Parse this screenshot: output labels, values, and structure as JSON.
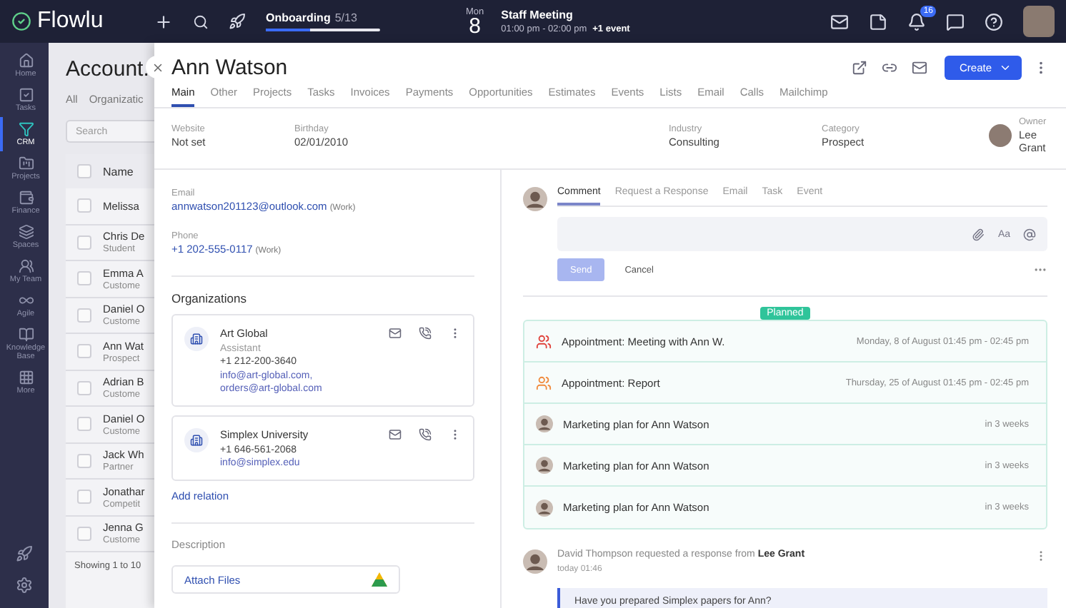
{
  "topbar": {
    "logo": "Flowlu",
    "onboarding": {
      "label": "Onboarding",
      "count": "5/13",
      "level": 0.385
    },
    "event": {
      "weekday": "Mon",
      "day": "8",
      "title": "Staff Meeting",
      "time": "01:00 pm - 02:00 pm",
      "more": "+1 event"
    },
    "notifications": "16"
  },
  "sidebar": [
    {
      "label": "Home",
      "selected": false
    },
    {
      "label": "Tasks",
      "selected": false
    },
    {
      "label": "CRM",
      "selected": true
    },
    {
      "label": "Projects",
      "selected": false
    },
    {
      "label": "Finance",
      "selected": false
    },
    {
      "label": "Spaces",
      "selected": false
    },
    {
      "label": "My Team",
      "selected": false
    },
    {
      "label": "Agile",
      "selected": false
    },
    {
      "label": "Knowledge Base",
      "selected": false
    },
    {
      "label": "More",
      "selected": false
    }
  ],
  "list": {
    "title": "Account.",
    "tabs": [
      {
        "label": "All",
        "selected": false
      },
      {
        "label": "Organizatic",
        "selected": false
      }
    ],
    "search": {
      "placeholder": "Search"
    },
    "column": "Name",
    "all_checked": false,
    "rows": [
      {
        "name": "Melissa",
        "sub": "",
        "checked": false
      },
      {
        "name": "Chris De",
        "sub": "Student",
        "checked": false
      },
      {
        "name": "Emma A",
        "sub": "Custome",
        "checked": false
      },
      {
        "name": "Daniel O",
        "sub": "Custome",
        "checked": false
      },
      {
        "name": "Ann Wat",
        "sub": "Prospect",
        "checked": false
      },
      {
        "name": "Adrian B",
        "sub": "Custome",
        "checked": false
      },
      {
        "name": "Daniel O",
        "sub": "Custome",
        "checked": false
      },
      {
        "name": "Jack Wh",
        "sub": "Partner",
        "checked": false
      },
      {
        "name": "Jonathar",
        "sub": "Competit",
        "checked": false
      },
      {
        "name": "Jenna G",
        "sub": "Custome",
        "checked": false
      }
    ],
    "footer": "Showing 1 to 10"
  },
  "drawer": {
    "title": "Ann Watson",
    "create": "Create",
    "tabs": [
      {
        "label": "Main",
        "selected": true
      },
      {
        "label": "Other",
        "selected": false
      },
      {
        "label": "Projects",
        "selected": false
      },
      {
        "label": "Tasks",
        "selected": false
      },
      {
        "label": "Invoices",
        "selected": false
      },
      {
        "label": "Payments",
        "selected": false
      },
      {
        "label": "Opportunities",
        "selected": false
      },
      {
        "label": "Estimates",
        "selected": false
      },
      {
        "label": "Events",
        "selected": false
      },
      {
        "label": "Lists",
        "selected": false
      },
      {
        "label": "Email",
        "selected": false
      },
      {
        "label": "Calls",
        "selected": false
      },
      {
        "label": "Mailchimp",
        "selected": false
      }
    ],
    "info": [
      {
        "label": "Website",
        "value": "Not set",
        "avatar": false
      },
      {
        "label": "Birthday",
        "value": "02/01/2010",
        "avatar": false
      },
      {
        "label": "Industry",
        "value": "Consulting",
        "avatar": false
      },
      {
        "label": "Category",
        "value": "Prospect",
        "avatar": false
      },
      {
        "label": "Owner",
        "value": "Lee Grant",
        "avatar": true
      }
    ],
    "contacts": [
      {
        "label": "Email",
        "value": "annwatson201123@outlook.com",
        "note": "(Work)"
      },
      {
        "label": "Phone",
        "value": "+1 202-555-0117",
        "note": "(Work)"
      }
    ],
    "organizations_title": "Organizations",
    "organizations": [
      {
        "name": "Art Global",
        "role": "Assistant",
        "phone": "+1 212-200-3640",
        "emails": [
          "info@art-global.com,",
          "orders@art-global.com"
        ]
      },
      {
        "name": "Simplex University",
        "phone": "+1 646-561-2068",
        "emails": [
          "info@simplex.edu"
        ]
      }
    ],
    "add_relation": "Add relation",
    "description_title": "Description",
    "attach": "Attach Files",
    "composer": {
      "tabs": [
        {
          "label": "Comment",
          "selected": true
        },
        {
          "label": "Request a Response",
          "selected": false
        },
        {
          "label": "Email",
          "selected": false
        },
        {
          "label": "Task",
          "selected": false
        },
        {
          "label": "Event",
          "selected": false
        }
      ],
      "format": "Aa",
      "send": "Send",
      "send_disabled": true,
      "cancel": "Cancel"
    },
    "planned_label": "Planned",
    "planned": [
      {
        "kind": "appointment",
        "color": "#e0413a",
        "title": "Appointment: Meeting with Ann W.",
        "when": "Monday, 8 of August 01:45 pm - 02:45 pm"
      },
      {
        "kind": "appointment",
        "color": "#f08a3c",
        "title": "Appointment: Report",
        "when": "Thursday, 25 of August 01:45 pm - 02:45 pm"
      },
      {
        "kind": "task",
        "title": "Marketing plan for Ann Watson",
        "when": "in 3 weeks"
      },
      {
        "kind": "task",
        "title": "Marketing plan for Ann Watson",
        "when": "in 3 weeks"
      },
      {
        "kind": "task",
        "title": "Marketing plan for Ann Watson",
        "when": "in 3 weeks"
      }
    ],
    "activity": {
      "text": "David Thompson requested a response from **Lee Grant**",
      "time": "today 01:46",
      "quote": "Have you prepared Simplex papers for Ann?"
    }
  }
}
